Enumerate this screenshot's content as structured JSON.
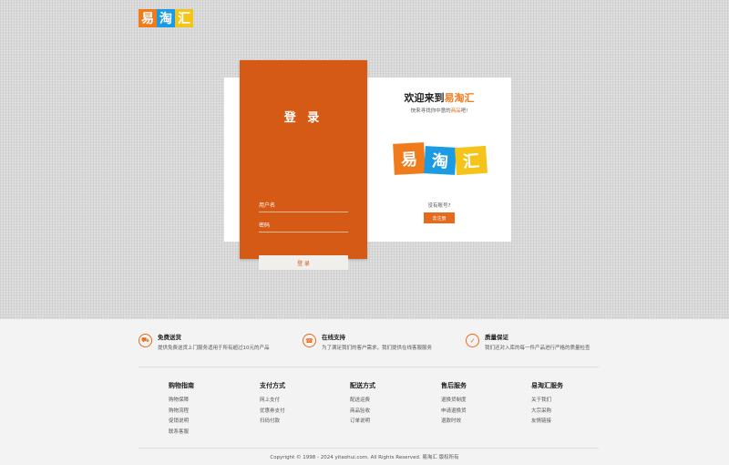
{
  "header": {
    "logo_chars": [
      "易",
      "淘",
      "汇"
    ]
  },
  "login": {
    "title": "登 录",
    "username_placeholder": "用户名",
    "password_placeholder": "密码",
    "submit_label": "登 录"
  },
  "welcome": {
    "prefix": "欢迎来到",
    "brand": "易淘汇",
    "sub_before": "快来寻找你中意的",
    "sub_highlight": "商品",
    "sub_after": "吧!",
    "logo_chars": [
      "易",
      "淘",
      "汇"
    ],
    "no_account": "没有账号?",
    "register_label": "去注册"
  },
  "services": [
    {
      "icon": "truck-icon",
      "glyph": "⛟",
      "title": "免费送货",
      "desc": "提供免费送货上门服务适用于所有超过10元的产品"
    },
    {
      "icon": "headset-icon",
      "glyph": "☎",
      "title": "在线支持",
      "desc": "为了满足我们的客户需求，我们提供在线客服服务"
    },
    {
      "icon": "shield-icon",
      "glyph": "✓",
      "title": "质量保证",
      "desc": "我们还对入库的每一件产品进行严格的质量检查"
    }
  ],
  "footer_columns": [
    {
      "title": "购物指南",
      "items": [
        "购物保障",
        "购物流程",
        "促销说明",
        "联系客服"
      ]
    },
    {
      "title": "支付方式",
      "items": [
        "网上支付",
        "优惠券支付",
        "扫码付款"
      ]
    },
    {
      "title": "配送方式",
      "items": [
        "配送运费",
        "商品验收",
        "订单说明"
      ]
    },
    {
      "title": "售后服务",
      "items": [
        "退换货制度",
        "申请退换货",
        "退款时效"
      ]
    },
    {
      "title": "易淘汇服务",
      "items": [
        "关于我们",
        "大宗采购",
        "友情链接"
      ]
    }
  ],
  "copyright": "Copyright © 1998 - 2024 yitaohui.com. All Rights Reserved. 易淘汇 版权所有",
  "colors": {
    "accent_orange": "#d45a15",
    "logo_orange": "#f07b1d",
    "logo_blue": "#1b9be3",
    "logo_yellow": "#f5c41a"
  }
}
